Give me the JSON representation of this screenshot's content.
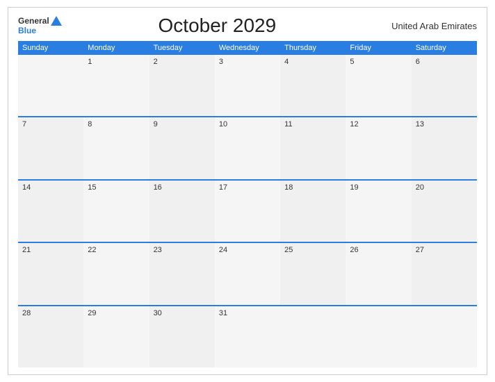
{
  "header": {
    "title": "October 2029",
    "country": "United Arab Emirates"
  },
  "logo": {
    "general": "General",
    "blue": "Blue"
  },
  "days": [
    "Sunday",
    "Monday",
    "Tuesday",
    "Wednesday",
    "Thursday",
    "Friday",
    "Saturday"
  ],
  "weeks": [
    [
      "",
      "1",
      "2",
      "3",
      "4",
      "5",
      "6"
    ],
    [
      "7",
      "8",
      "9",
      "10",
      "11",
      "12",
      "13"
    ],
    [
      "14",
      "15",
      "16",
      "17",
      "18",
      "19",
      "20"
    ],
    [
      "21",
      "22",
      "23",
      "24",
      "25",
      "26",
      "27"
    ],
    [
      "28",
      "29",
      "30",
      "31",
      "",
      "",
      ""
    ]
  ]
}
